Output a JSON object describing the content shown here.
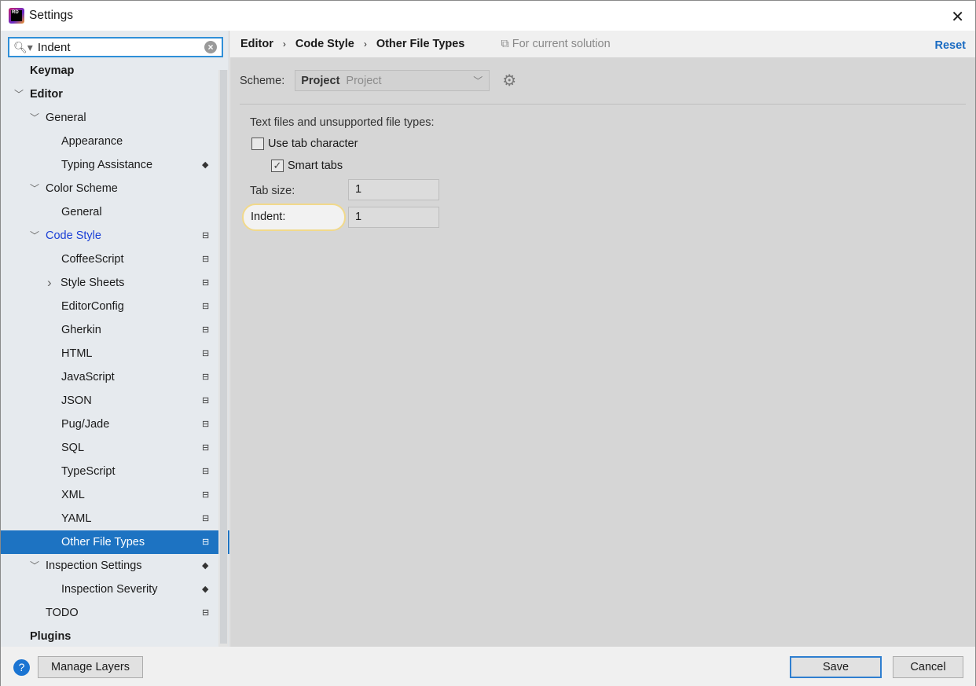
{
  "window": {
    "title": "Settings",
    "logo_text": "RD"
  },
  "search": {
    "value": "Indent"
  },
  "tree": [
    {
      "label": "Keymap",
      "level": 0,
      "bold": true
    },
    {
      "label": "Editor",
      "level": 0,
      "bold": true,
      "expanded": true
    },
    {
      "label": "General",
      "level": 1,
      "expanded": true
    },
    {
      "label": "Appearance",
      "level": 2
    },
    {
      "label": "Typing Assistance",
      "level": 2,
      "icon": "layers-icon"
    },
    {
      "label": "Color Scheme",
      "level": 1,
      "expanded": true
    },
    {
      "label": "General",
      "level": 2
    },
    {
      "label": "Code Style",
      "level": 1,
      "expanded": true,
      "highlight": true,
      "icon": "briefcase-icon"
    },
    {
      "label": "CoffeeScript",
      "level": 2,
      "icon": "briefcase-icon"
    },
    {
      "label": "Style Sheets",
      "level": 2,
      "collapsed": true,
      "icon": "briefcase-icon"
    },
    {
      "label": "EditorConfig",
      "level": 2,
      "icon": "briefcase-icon"
    },
    {
      "label": "Gherkin",
      "level": 2,
      "icon": "briefcase-icon"
    },
    {
      "label": "HTML",
      "level": 2,
      "icon": "briefcase-icon"
    },
    {
      "label": "JavaScript",
      "level": 2,
      "icon": "briefcase-icon"
    },
    {
      "label": "JSON",
      "level": 2,
      "icon": "briefcase-icon"
    },
    {
      "label": "Pug/Jade",
      "level": 2,
      "icon": "briefcase-icon"
    },
    {
      "label": "SQL",
      "level": 2,
      "icon": "briefcase-icon"
    },
    {
      "label": "TypeScript",
      "level": 2,
      "icon": "briefcase-icon"
    },
    {
      "label": "XML",
      "level": 2,
      "icon": "briefcase-icon"
    },
    {
      "label": "YAML",
      "level": 2,
      "icon": "briefcase-icon"
    },
    {
      "label": "Other File Types",
      "level": 2,
      "selected": true,
      "icon": "briefcase-icon"
    },
    {
      "label": "Inspection Settings",
      "level": 1,
      "expanded": true,
      "icon": "layers-icon"
    },
    {
      "label": "Inspection Severity",
      "level": 2,
      "icon": "layers-icon"
    },
    {
      "label": "TODO",
      "level": 1,
      "icon": "briefcase-icon"
    },
    {
      "label": "Plugins",
      "level": 0,
      "bold": true
    }
  ],
  "breadcrumb": [
    "Editor",
    "Code Style",
    "Other File Types"
  ],
  "scope": "For current solution",
  "reset": "Reset",
  "scheme": {
    "label": "Scheme:",
    "value_bold": "Project",
    "value_gray": "Project"
  },
  "section": "Text files and unsupported file types:",
  "use_tab": {
    "label": "Use tab character",
    "checked": false
  },
  "smart_tabs": {
    "label": "Smart tabs",
    "checked": true
  },
  "tab_size": {
    "label": "Tab size:",
    "value": "1"
  },
  "indent": {
    "label": "Indent:",
    "value": "1"
  },
  "footer": {
    "manage_layers": "Manage Layers",
    "save": "Save",
    "cancel": "Cancel",
    "help": "?"
  }
}
